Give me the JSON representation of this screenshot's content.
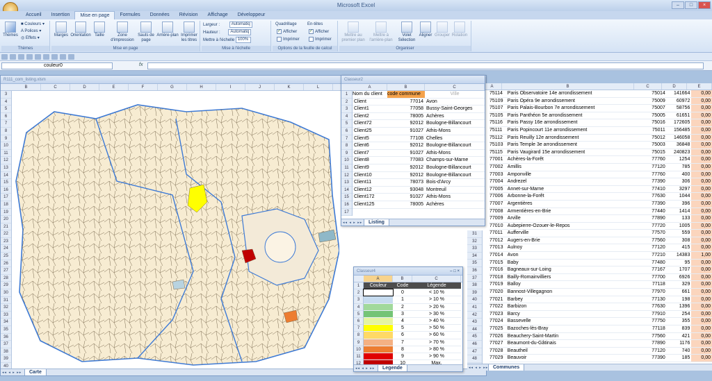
{
  "app": {
    "title": "Microsoft Excel",
    "tabs": [
      "Accueil",
      "Insertion",
      "Mise en page",
      "Formules",
      "Données",
      "Révision",
      "Affichage",
      "Développeur"
    ],
    "active_tab": "Mise en page"
  },
  "ribbon": {
    "themes": {
      "themes_label": "Thèmes",
      "couleurs": "Couleurs",
      "polices": "Polices",
      "effets": "Effets",
      "group": "Thèmes"
    },
    "page_setup": {
      "marges": "Marges",
      "orientation": "Orientation",
      "taille": "Taille",
      "zone": "Zone d'impression",
      "sauts": "Sauts de page",
      "arriere": "Arrière-plan",
      "imprimer_titres": "Imprimer les titres",
      "group": "Mise en page"
    },
    "scale": {
      "largeur": "Largeur :",
      "largeur_val": "Automatiq",
      "hauteur": "Hauteur :",
      "hauteur_val": "Automatiq",
      "echelle": "Mettre à l'échelle",
      "echelle_val": "100%",
      "group": "Mise à l'échelle"
    },
    "sheet_options": {
      "quadrillage": "Quadrillage",
      "en_tetes": "En-têtes",
      "afficher": "Afficher",
      "imprimer": "Imprimer",
      "group": "Options de la feuille de calcul"
    },
    "arrange": {
      "premier": "Mettre au premier plan",
      "arriere": "Mettre à l'arrière-plan",
      "volet": "Volet Sélection",
      "aligner": "Aligner",
      "grouper": "Grouper",
      "rotation": "Rotation",
      "group": "Organiser"
    }
  },
  "formula_bar": {
    "name_box": "couleur0",
    "fx": "fx",
    "value": ""
  },
  "carte": {
    "title": "R111_com_listing.xlsm",
    "columns": [
      "B",
      "C",
      "D",
      "E",
      "F",
      "G",
      "H",
      "I",
      "J",
      "K",
      "L"
    ],
    "rows": [
      "3",
      "4",
      "5",
      "6",
      "7",
      "8",
      "9",
      "10",
      "11",
      "12",
      "13",
      "14",
      "15",
      "16",
      "17",
      "18",
      "19",
      "20",
      "21",
      "22",
      "23",
      "24",
      "25",
      "26",
      "27",
      "28",
      "29",
      "30",
      "31",
      "32",
      "33",
      "34",
      "35",
      "36",
      "37",
      "38",
      "39",
      "40",
      "41",
      "42",
      "43",
      "44",
      "45",
      "46",
      "47",
      "48",
      "49",
      "50",
      "51",
      "52",
      "53"
    ],
    "sheet_tab": "Carte"
  },
  "classeur2": {
    "title": "Classeur2",
    "columns": [
      "A",
      "B",
      "C"
    ],
    "rows": [
      "1",
      "2",
      "3",
      "4",
      "5",
      "6",
      "7",
      "8",
      "9",
      "10",
      "11",
      "12",
      "13",
      "14",
      "15",
      "16",
      "17"
    ],
    "headers": [
      "Nom du client",
      "code commune",
      "Ville"
    ],
    "data": [
      [
        "Client",
        "77014",
        "Avon"
      ],
      [
        "Client1",
        "77058",
        "Bussy-Saint-Georges"
      ],
      [
        "Client2",
        "78005",
        "Achères"
      ],
      [
        "Client72",
        "92012",
        "Boulogne-Billancourt"
      ],
      [
        "Client25",
        "91027",
        "Athis-Mons"
      ],
      [
        "Client5",
        "77108",
        "Chelles"
      ],
      [
        "Client6",
        "92012",
        "Boulogne-Billancourt"
      ],
      [
        "Client7",
        "91027",
        "Athis-Mons"
      ],
      [
        "Client8",
        "77083",
        "Champs-sur-Marne"
      ],
      [
        "Client9",
        "92012",
        "Boulogne-Billancourt"
      ],
      [
        "Client10",
        "92012",
        "Boulogne-Billancourt"
      ],
      [
        "Client11",
        "78073",
        "Bois-d'Arcy"
      ],
      [
        "Client12",
        "93048",
        "Montreuil"
      ],
      [
        "Client172",
        "91027",
        "Athis-Mons"
      ],
      [
        "Client125",
        "78005",
        "Achères"
      ]
    ],
    "sheet_tab": "Listing"
  },
  "classeur4": {
    "title": "Classeur4",
    "columns": [
      "A",
      "B",
      "C"
    ],
    "headers": [
      "Couleur",
      "Code",
      "Légende"
    ],
    "rows": [
      "1",
      "2",
      "3",
      "4",
      "5",
      "6",
      "7",
      "8",
      "9",
      "10",
      "11",
      "12"
    ],
    "legend": [
      {
        "color": "#ffffff",
        "code": "0",
        "label": "< 10 %"
      },
      {
        "color": "#c6dbef",
        "code": "1",
        "label": "> 10 %"
      },
      {
        "color": "#a1d99b",
        "code": "2",
        "label": "> 20 %"
      },
      {
        "color": "#74c476",
        "code": "3",
        "label": "> 30 %"
      },
      {
        "color": "#e5f5a0",
        "code": "4",
        "label": "> 40 %"
      },
      {
        "color": "#ffff00",
        "code": "5",
        "label": "> 50 %"
      },
      {
        "color": "#ffd966",
        "code": "6",
        "label": "> 60 %"
      },
      {
        "color": "#f4b183",
        "code": "7",
        "label": "> 70 %"
      },
      {
        "color": "#ed7d31",
        "code": "8",
        "label": "> 80 %"
      },
      {
        "color": "#e00000",
        "code": "9",
        "label": "> 90 %"
      },
      {
        "color": "#c00000",
        "code": "10",
        "label": "Max."
      }
    ],
    "sheet_tab": "Legende"
  },
  "communes": {
    "columns": [
      "A",
      "B",
      "C",
      "D",
      "E"
    ],
    "rows": [
      "31",
      "32",
      "33",
      "34",
      "35",
      "36",
      "37",
      "38",
      "39",
      "40",
      "41",
      "42",
      "43",
      "44",
      "45",
      "46",
      "47",
      "48",
      "49",
      "50",
      "51",
      "52",
      "53"
    ],
    "data": [
      [
        "75114",
        "Paris Observatoire 14e arrondissement",
        "75014",
        "141664",
        "0,00"
      ],
      [
        "75109",
        "Paris Opéra 9e arrondissement",
        "75009",
        "60972",
        "0,00"
      ],
      [
        "75107",
        "Paris Palais-Bourbon 7e arrondissement",
        "75007",
        "58756",
        "0,00"
      ],
      [
        "75105",
        "Paris Panthéon 5e arrondissement",
        "75005",
        "61651",
        "0,00"
      ],
      [
        "75116",
        "Paris Passy 16e arrondissement",
        "75016",
        "172605",
        "0,00"
      ],
      [
        "75111",
        "Paris Popincourt 11e arrondissement",
        "75011",
        "156485",
        "0,00"
      ],
      [
        "75112",
        "Paris Reuilly 12e arrondissement",
        "75012",
        "146058",
        "0,00"
      ],
      [
        "75103",
        "Paris Temple 3e arrondissement",
        "75003",
        "36848",
        "0,00"
      ],
      [
        "75115",
        "Paris Vaugirard 15e arrondissement",
        "75015",
        "240823",
        "0,00"
      ],
      [
        "77001",
        "Achères-la-Forêt",
        "77760",
        "1254",
        "0,00"
      ],
      [
        "77002",
        "Amillis",
        "77120",
        "785",
        "0,00"
      ],
      [
        "77003",
        "Amponville",
        "77760",
        "400",
        "0,00"
      ],
      [
        "77004",
        "Andrezel",
        "77390",
        "306",
        "0,00"
      ],
      [
        "77005",
        "Annet-sur-Marne",
        "77410",
        "3297",
        "0,00"
      ],
      [
        "77006",
        "Arbonne-la-Forêt",
        "77630",
        "1044",
        "0,00"
      ],
      [
        "77007",
        "Argentières",
        "77390",
        "396",
        "0,00"
      ],
      [
        "77008",
        "Armentières-en-Brie",
        "77440",
        "1414",
        "0,00"
      ],
      [
        "77009",
        "Arville",
        "77890",
        "133",
        "0,00"
      ],
      [
        "77010",
        "Aubepierre-Ozouer-le-Repos",
        "77720",
        "1005",
        "0,00"
      ],
      [
        "77011",
        "Aufferville",
        "77570",
        "559",
        "0,00"
      ],
      [
        "77012",
        "Augers-en-Brie",
        "77560",
        "308",
        "0,00"
      ],
      [
        "77013",
        "Aulnoy",
        "77120",
        "415",
        "0,00"
      ],
      [
        "77014",
        "Avon",
        "77210",
        "14383",
        "1,00"
      ],
      [
        "77015",
        "Baby",
        "77480",
        "95",
        "0,00"
      ],
      [
        "77016",
        "Bagneaux-sur-Loing",
        "77167",
        "1707",
        "0,00"
      ],
      [
        "77018",
        "Bailly-Romainvilliers",
        "77700",
        "6926",
        "0,00"
      ],
      [
        "77019",
        "Balloy",
        "77118",
        "329",
        "0,00"
      ],
      [
        "77020",
        "Bannost-Villegagnon",
        "77970",
        "661",
        "0,00"
      ],
      [
        "77021",
        "Barbey",
        "77130",
        "198",
        "0,00"
      ],
      [
        "77022",
        "Barbizon",
        "77630",
        "1396",
        "0,00"
      ],
      [
        "77023",
        "Barcy",
        "77910",
        "254",
        "0,00"
      ],
      [
        "77024",
        "Bassevelle",
        "77750",
        "355",
        "0,00"
      ],
      [
        "77025",
        "Bazoches-lès-Bray",
        "77118",
        "839",
        "0,00"
      ],
      [
        "77026",
        "Beauchery-Saint-Martin",
        "77560",
        "421",
        "0,00"
      ],
      [
        "77027",
        "Beaumont-du-Gâtinais",
        "77890",
        "1176",
        "0,00"
      ],
      [
        "77028",
        "Beautheil",
        "77120",
        "740",
        "0,00"
      ],
      [
        "77029",
        "Beauvoir",
        "77390",
        "185",
        "0,00"
      ]
    ],
    "sheet_tab": "Communes"
  }
}
